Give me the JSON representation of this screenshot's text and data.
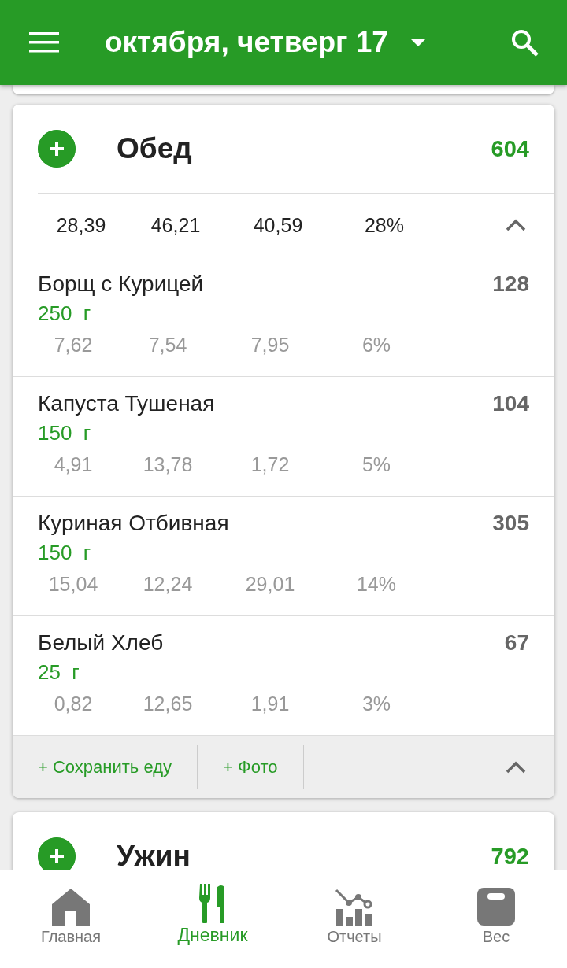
{
  "app_bar": {
    "title": "октября, четверг 17"
  },
  "meals": [
    {
      "name": "Обед",
      "calories": "604",
      "totals": [
        "28,39",
        "46,21",
        "40,59",
        "28%"
      ],
      "foods": [
        {
          "name": "Борщ с Курицей",
          "amount": "250  г",
          "calories": "128",
          "macros": [
            "7,62",
            "7,54",
            "7,95",
            "6%"
          ]
        },
        {
          "name": "Капуста Тушеная",
          "amount": "150  г",
          "calories": "104",
          "macros": [
            "4,91",
            "13,78",
            "1,72",
            "5%"
          ]
        },
        {
          "name": "Куриная Отбивная",
          "amount": "150  г",
          "calories": "305",
          "macros": [
            "15,04",
            "12,24",
            "29,01",
            "14%"
          ]
        },
        {
          "name": "Белый Хлеб",
          "amount": "25  г",
          "calories": "67",
          "macros": [
            "0,82",
            "12,65",
            "1,91",
            "3%"
          ]
        }
      ],
      "actions": [
        "+ Сохранить еду",
        "+ Фото"
      ]
    },
    {
      "name": "Ужин",
      "calories": "792"
    }
  ],
  "bottom_nav": [
    {
      "kind": "home",
      "label": "Главная",
      "selected": false
    },
    {
      "kind": "diary",
      "label": "Дневник",
      "selected": true
    },
    {
      "kind": "reports",
      "label": "Отчеты",
      "selected": false
    },
    {
      "kind": "weight",
      "label": "Вес",
      "selected": false
    }
  ]
}
